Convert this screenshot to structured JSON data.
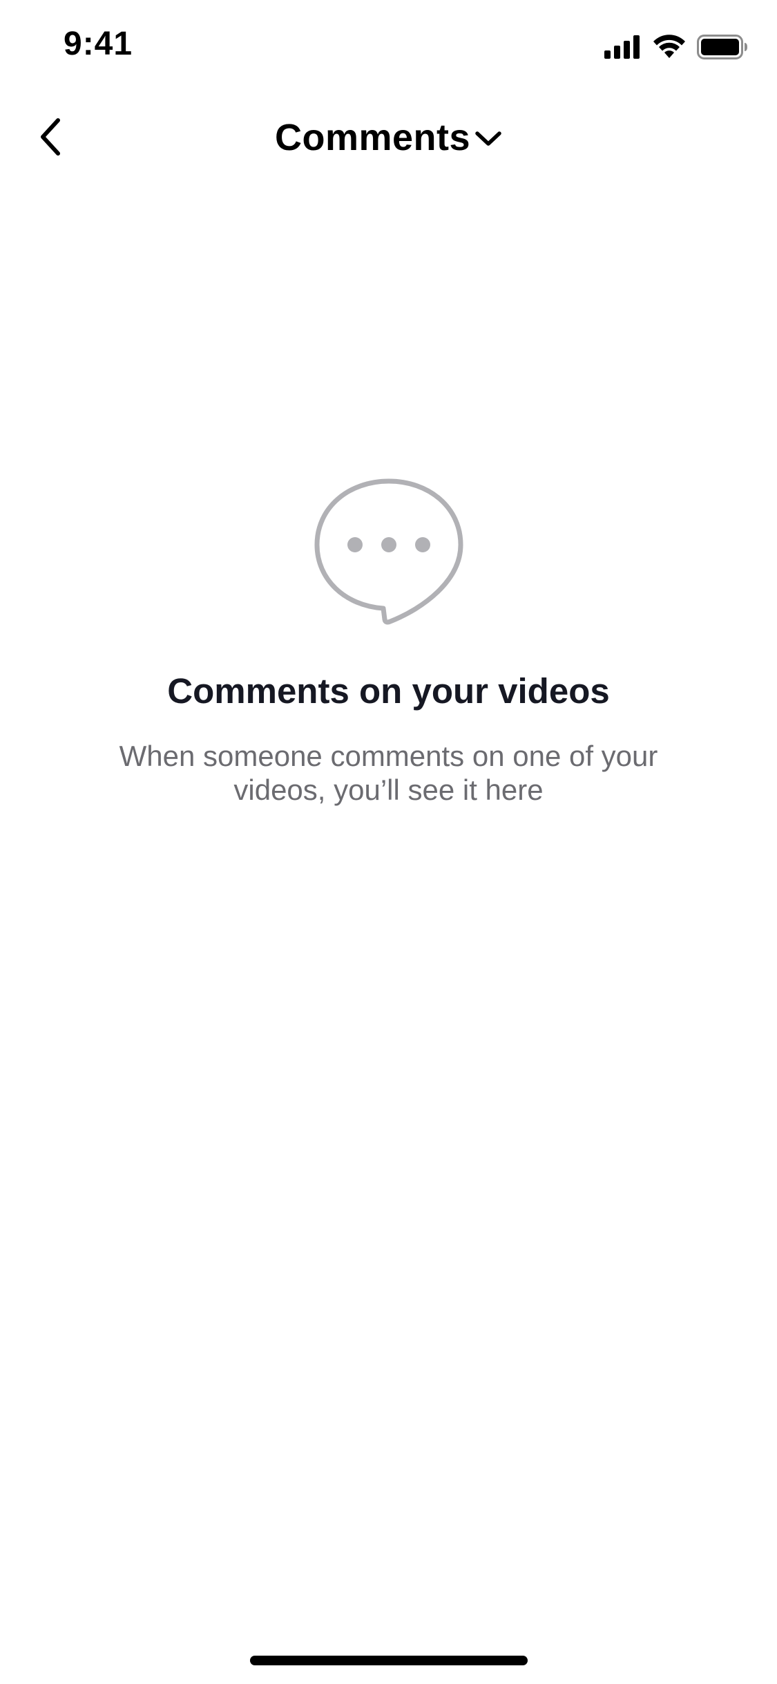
{
  "status_bar": {
    "time": "9:41",
    "icons": [
      "signal-icon",
      "wifi-icon",
      "battery-icon"
    ]
  },
  "nav": {
    "back_icon": "chevron-left-icon",
    "title": "Comments",
    "dropdown_icon": "chevron-down-icon"
  },
  "empty_state": {
    "icon": "comment-bubble-icon",
    "title": "Comments on your videos",
    "description": "When someone comments on one of your videos, you’ll see it here"
  },
  "colors": {
    "icon_gray": "#b1b1b5",
    "text_primary": "#161823",
    "text_secondary": "#6b6b70"
  }
}
